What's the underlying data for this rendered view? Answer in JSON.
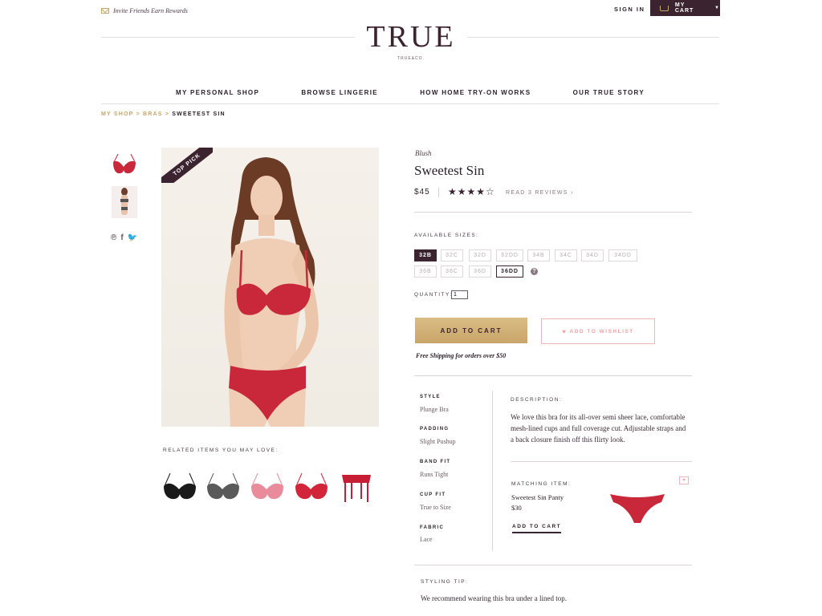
{
  "header": {
    "invite_text": "Invite Friends Earn Rewards",
    "sign_in": "SIGN IN",
    "cart_label": "MY CART",
    "logo_text": "TRUE",
    "logo_sub": "TRUE&CO."
  },
  "nav": {
    "items": [
      "MY PERSONAL SHOP",
      "BROWSE LINGERIE",
      "HOW HOME TRY-ON WORKS",
      "OUR TRUE STORY"
    ]
  },
  "breadcrumb": {
    "shop": "MY SHOP",
    "sep": ">",
    "bras": "BRAS",
    "current": "SWEETEST SIN"
  },
  "gallery": {
    "badge": "TOP PICK"
  },
  "related": {
    "title": "RELATED ITEMS YOU MAY LOVE:",
    "items": [
      {
        "icon": "black-bra",
        "color": "#1a1a1a"
      },
      {
        "icon": "gray-bra",
        "color": "#5a5a5a"
      },
      {
        "icon": "pink-bra",
        "color": "#e98b9a"
      },
      {
        "icon": "red-bra",
        "color": "#d3253a"
      },
      {
        "icon": "garter-belt",
        "color": "#c81e35"
      }
    ]
  },
  "product": {
    "brand": "Blush",
    "title": "Sweetest Sin",
    "price": "$45",
    "stars": "★★★★☆",
    "rating": 4,
    "reviews": "READ 3 REVIEWS ›",
    "sizes_label": "AVAILABLE SIZES:",
    "sizes_row1": [
      "32B",
      "32C",
      "32D",
      "32DD",
      "34B",
      "34C",
      "34D",
      "34DD"
    ],
    "sizes_row2": [
      "36B",
      "36C",
      "36D",
      "36DD"
    ],
    "selected_size": "32B",
    "outlined_size": "36DD",
    "help": "?",
    "quantity_label": "QUANTITY:",
    "quantity": "1",
    "add_to_cart": "ADD TO CART",
    "wishlist": "ADD TO WISHLIST",
    "shipping": "Free Shipping for orders over $50"
  },
  "specs": [
    {
      "label": "STYLE",
      "value": "Plunge Bra"
    },
    {
      "label": "PADDING",
      "value": "Slight Pushup"
    },
    {
      "label": "BAND FIT",
      "value": "Runs Tight"
    },
    {
      "label": "CUP FIT",
      "value": "True to Size"
    },
    {
      "label": "FABRIC",
      "value": "Lace"
    }
  ],
  "description": {
    "label": "DESCRIPTION:",
    "text": "We love this bra for its all-over semi sheer lace, comfortable mesh-lined cups and full coverage cut. Adjustable straps and a back closure finish off this flirty look."
  },
  "matching": {
    "label": "MATCHING ITEM:",
    "name": "Sweetest Sin Panty",
    "price": "$30",
    "add": "ADD TO CART"
  },
  "styling": {
    "label": "STYLING TIP:",
    "text": "We recommend wearing this bra under a lined top."
  },
  "colors": {
    "plum": "#3b2430",
    "gold": "#c9a56a",
    "red": "#c8283a",
    "pink": "#f0a2a2"
  }
}
